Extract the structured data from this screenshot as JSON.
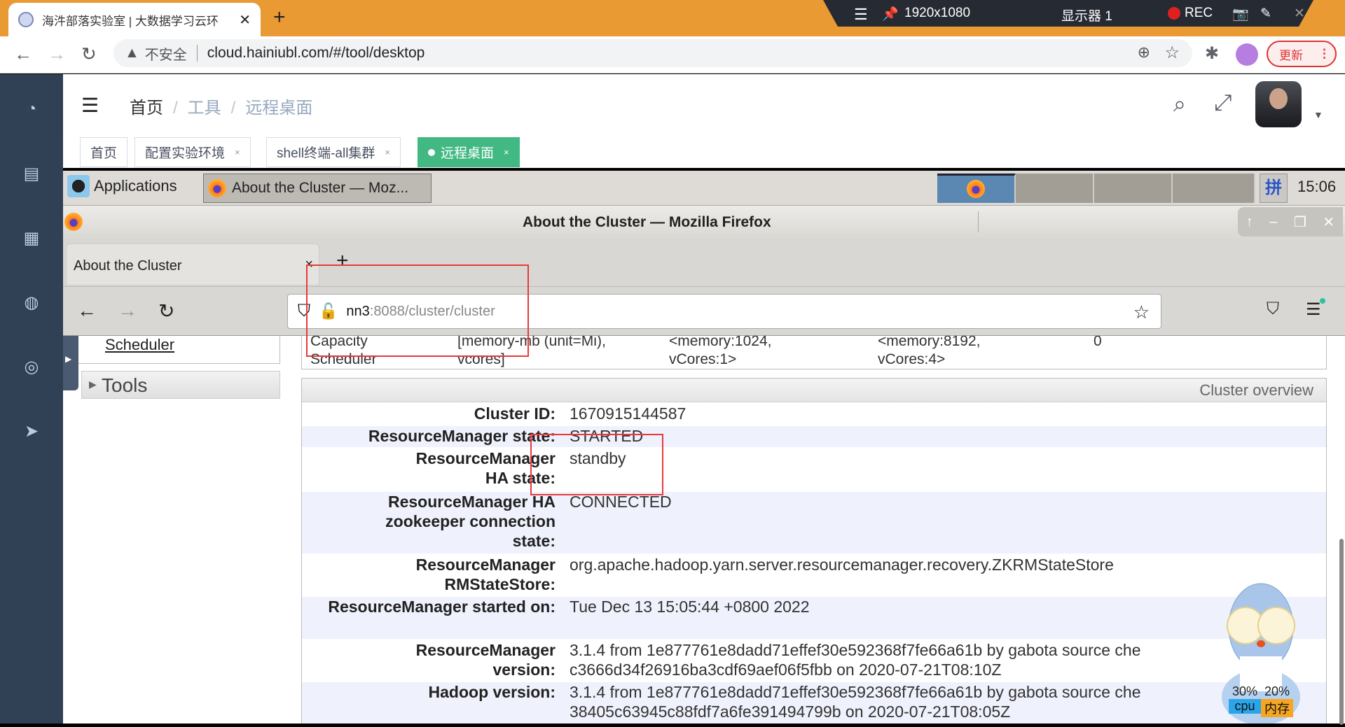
{
  "chrome": {
    "tab_title": "海汼部落实验室 | 大数据学习云环",
    "url": "cloud.hainiubl.com/#/tool/desktop",
    "security_label": "不安全",
    "update_label": "更新",
    "record_bar": {
      "resolution": "1920x1080",
      "display": "显示器 1",
      "rec_label": "REC"
    }
  },
  "app": {
    "breadcrumb": [
      "首页",
      "工具",
      "远程桌面"
    ],
    "breadcrumb_sep": "/",
    "tags": [
      {
        "label": "首页",
        "closable": false,
        "active": false
      },
      {
        "label": "配置实验环境",
        "closable": true,
        "active": false
      },
      {
        "label": "shell终端-all集群",
        "closable": true,
        "active": false
      },
      {
        "label": "远程桌面",
        "closable": true,
        "active": true
      }
    ],
    "tag_close": "×",
    "accent_color": "#42b983",
    "sidebar_color": "#304156"
  },
  "desktop": {
    "applications_label": "Applications",
    "taskbar_window": "About the Cluster — Moz...",
    "ime_label": "拼",
    "clock": "15:06"
  },
  "firefox": {
    "window_title": "About the Cluster — Mozilla Firefox",
    "tab_label": "About the Cluster",
    "tab_close": "×",
    "new_tab": "+",
    "url_host": "nn3",
    "url_path": ":8088/cluster/cluster"
  },
  "yarn_page": {
    "nav_link_scheduler": "Scheduler",
    "nav_tools": "Tools",
    "scheduler_row": {
      "label_line1": "Capacity",
      "label_line2": "Scheduler",
      "resource_line1": "[memory-mb (unit=Mi),",
      "resource_line2": "vcores]",
      "min_line1": "<memory:1024,",
      "min_line2": "vCores:1>",
      "max_line1": "<memory:8192,",
      "max_line2": "vCores:4>",
      "value": "0"
    },
    "overview_title": "Cluster overview",
    "overview": [
      {
        "k": "Cluster ID:",
        "v": "1670915144587"
      },
      {
        "k": "ResourceManager state:",
        "v": "STARTED"
      },
      {
        "k": "ResourceManager HA state:",
        "v": "standby"
      },
      {
        "k": "ResourceManager HA zookeeper connection state:",
        "v": "CONNECTED"
      },
      {
        "k": "ResourceManager RMStateStore:",
        "v": "org.apache.hadoop.yarn.server.resourcemanager.recovery.ZKRMStateStore"
      },
      {
        "k": "ResourceManager started on:",
        "v": "Tue Dec 13 15:05:44 +0800 2022"
      },
      {
        "k": "ResourceManager version:",
        "v": "3.1.4 from 1e877761e8dadd71effef30e592368f7fe66a61b by gabota source che\nc3666d34f26916ba3cdf69aef06f5fbb on 2020-07-21T08:10Z"
      },
      {
        "k": "Hadoop version:",
        "v": "3.1.4 from 1e877761e8dadd71effef30e592368f7fe66a61b by gabota source che\n38405c63945c88fdf7a6fe391494799b on 2020-07-21T08:05Z"
      }
    ]
  },
  "monitor": {
    "cpu_percent": "30%",
    "cpu_label": "cpu",
    "mem_percent": "20%",
    "mem_label": "内存"
  }
}
